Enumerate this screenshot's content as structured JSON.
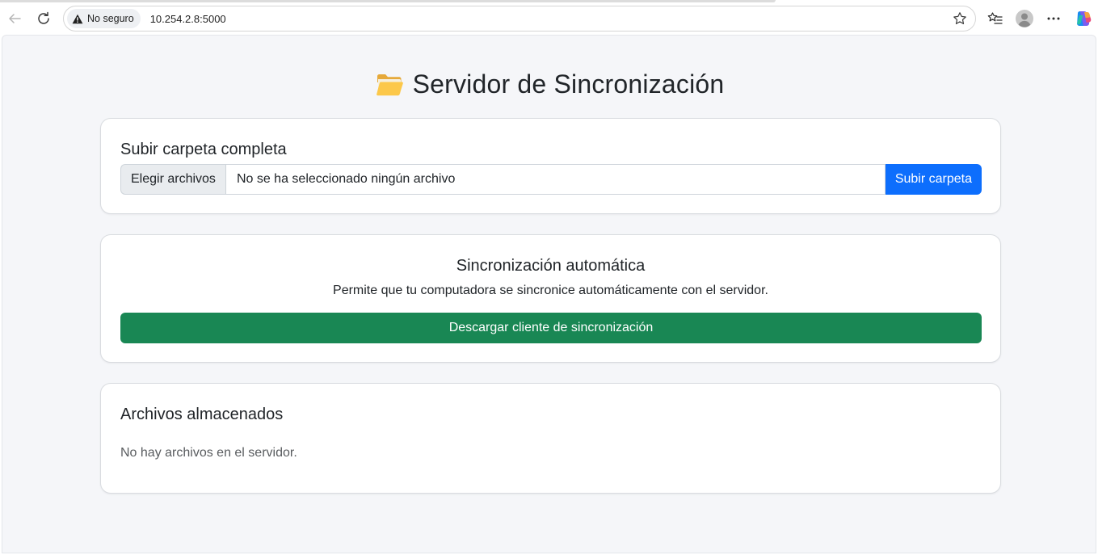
{
  "browser": {
    "security_label": "No seguro",
    "url": "10.254.2.8:5000"
  },
  "page": {
    "title": "Servidor de Sincronización"
  },
  "upload": {
    "title": "Subir carpeta completa",
    "choose_label": "Elegir archivos",
    "file_status": "No se ha seleccionado ningún archivo",
    "submit_label": "Subir carpeta"
  },
  "sync": {
    "title": "Sincronización automática",
    "description": "Permite que tu computadora se sincronice automáticamente con el servidor.",
    "download_label": "Descargar cliente de sincronización"
  },
  "files": {
    "title": "Archivos almacenados",
    "empty_message": "No hay archivos en el servidor."
  },
  "colors": {
    "primary": "#0d6efd",
    "success": "#198754",
    "page_bg": "#f5f6f9"
  },
  "icons": [
    "back-arrow-icon",
    "reload-icon",
    "warning-icon",
    "star-icon",
    "favorites-icon",
    "profile-icon",
    "more-icon",
    "copilot-icon",
    "folder-open-icon"
  ]
}
